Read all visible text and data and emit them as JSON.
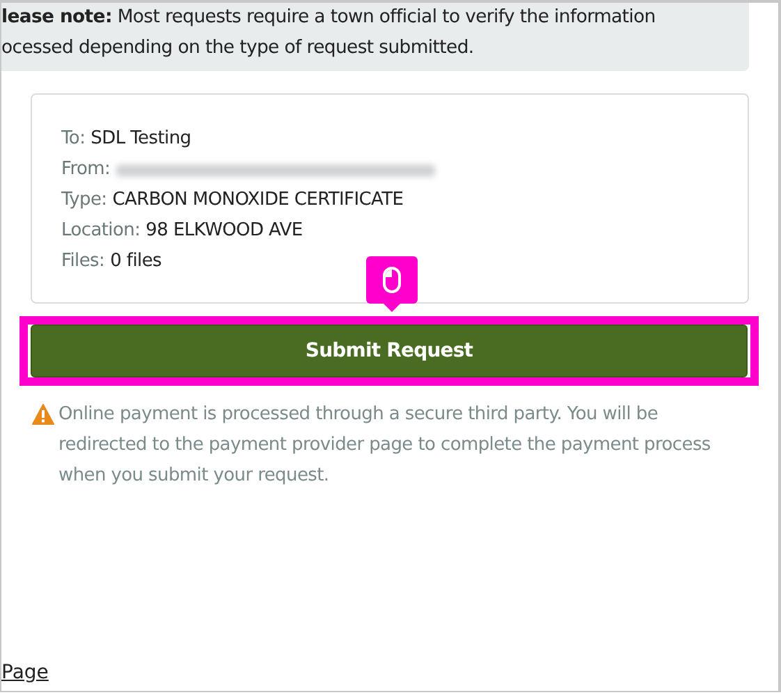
{
  "note": {
    "label": "lease note:",
    "text": "Most requests require a town official to verify the information",
    "line_2": "ocessed depending on the type of request submitted."
  },
  "summary": [
    {
      "label": "To:",
      "value": "SDL Testing"
    },
    {
      "label": "From:",
      "redacted": true
    },
    {
      "label": "Type:",
      "value": "CARBON MONOXIDE CERTIFICATE"
    },
    {
      "label": "Location:",
      "value": "98 ELKWOOD AVE"
    },
    {
      "label": "Files:",
      "value": "0 files"
    }
  ],
  "highlight": {
    "kind": "click"
  },
  "submit_button": "Submit Request",
  "warning": "Online payment is processed through a secure third party. You will be redirected to the payment provider page to complete the payment process when you submit your request.",
  "footer_link": "Page"
}
